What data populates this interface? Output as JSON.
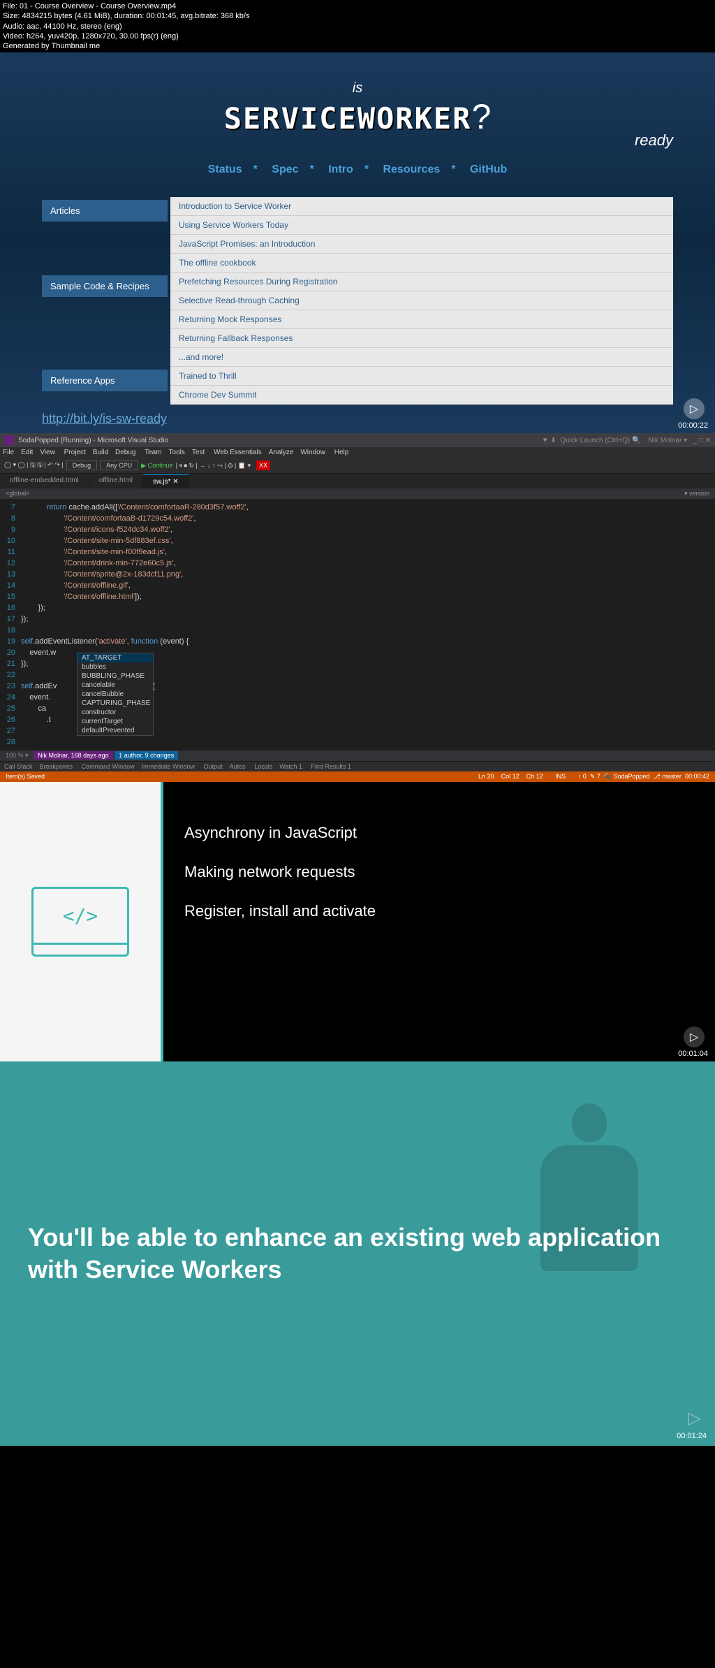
{
  "meta": {
    "file": "File: 01 - Course Overview - Course Overview.mp4",
    "size": "Size: 4834215 bytes (4.61 MiB), duration: 00:01:45, avg.bitrate: 368 kb/s",
    "audio": "Audio: aac, 44100 Hz, stereo (eng)",
    "video": "Video: h264, yuv420p, 1280x720, 30.00 fps(r) (eng)",
    "gen": "Generated by Thumbnail me"
  },
  "panel1": {
    "logo_is": "is",
    "logo_main": "SERVICEWORKER",
    "logo_ready": "ready",
    "logo_q": "?",
    "nav": [
      "Status",
      "*",
      "Spec",
      "*",
      "Intro",
      "*",
      "Resources",
      "*",
      "GitHub"
    ],
    "sections": [
      {
        "header": "Articles",
        "items": [
          "Introduction to Service Worker",
          "Using Service Workers Today",
          "JavaScript Promises: an Introduction",
          "The offline cookbook"
        ]
      },
      {
        "header": "Sample Code & Recipes",
        "items": [
          "Prefetching Resources During Registration",
          "Selective Read-through Caching",
          "Returning Mock Responses",
          "Returning Fallback Responses",
          "...and more!"
        ]
      },
      {
        "header": "Reference Apps",
        "items": [
          "Trained to Thrill",
          "Chrome Dev Summit"
        ]
      }
    ],
    "url": "http://bit.ly/is-sw-ready",
    "timestamp": "00:00:22"
  },
  "panel2": {
    "title": "SodaPopped (Running) - Microsoft Visual Studio",
    "quicklaunch": "Quick Launch (Ctrl+Q)",
    "user": "Nik Molnar",
    "menu": [
      "File",
      "Edit",
      "View",
      "Project",
      "Build",
      "Debug",
      "Team",
      "Tools",
      "Test",
      "Web Essentials",
      "Analyze",
      "Window",
      "Help"
    ],
    "toolbar_debug": "Debug",
    "toolbar_cpu": "Any CPU",
    "toolbar_continue": "Continue",
    "tabs": [
      "offline-embedded.html",
      "offline.html",
      "sw.js*"
    ],
    "breadcrumb_left": "<global>",
    "breadcrumb_right": "version",
    "code": [
      {
        "n": "7",
        "t": "            return cache.addAll(['/Content/comfortaaR-280d3f57.woff2',"
      },
      {
        "n": "8",
        "t": "                    '/Content/comfortaaB-d1729c54.woff2',"
      },
      {
        "n": "9",
        "t": "                    '/Content/icons-f524dc34.woff2',"
      },
      {
        "n": "10",
        "t": "                    '/Content/site-min-5df883ef.css',"
      },
      {
        "n": "11",
        "t": "                    '/Content/site-min-f00f9ead.js',"
      },
      {
        "n": "12",
        "t": "                    '/Content/drink-min-772e60c5.js',"
      },
      {
        "n": "13",
        "t": "                    '/Content/sprite@2x-183dcf11.png',"
      },
      {
        "n": "14",
        "t": "                    '/Content/offline.gif',"
      },
      {
        "n": "15",
        "t": "                    '/Content/offline.html']);"
      },
      {
        "n": "16",
        "t": "        });"
      },
      {
        "n": "17",
        "t": "});"
      },
      {
        "n": "18",
        "t": ""
      },
      {
        "n": "19",
        "t": "self.addEventListener('activate', function (event) {"
      },
      {
        "n": "20",
        "t": "    event.w"
      },
      {
        "n": "21",
        "t": "});"
      },
      {
        "n": "22",
        "t": ""
      },
      {
        "n": "23",
        "t": "self.addEv                    unction (event) {"
      },
      {
        "n": "24",
        "t": "    event."
      },
      {
        "n": "25",
        "t": "        ca                     st)"
      },
      {
        "n": "26",
        "t": "            .t"
      },
      {
        "n": "27",
        "t": ""
      },
      {
        "n": "28",
        "t": ""
      }
    ],
    "intellisense": [
      "AT_TARGET",
      "bubbles",
      "BUBBLING_PHASE",
      "cancelable",
      "cancelBubble",
      "CAPTURING_PHASE",
      "constructor",
      "currentTarget",
      "defaultPrevented"
    ],
    "scale": "100 %",
    "git_author": "Nik Molnar, 168 days ago",
    "git_changes": "1 author, 9 changes",
    "bottom_tabs": [
      "Call Stack",
      "Breakpoints",
      "Command Window",
      "Immediate Window",
      "Output",
      "Autos",
      "Locals",
      "Watch 1",
      "Find Results 1"
    ],
    "status_saved": "Item(s) Saved",
    "status_ln": "Ln 20",
    "status_col": "Col 12",
    "status_ch": "Ch 12",
    "status_ins": "INS",
    "status_up": "↑ 0",
    "status_pen": "✎ 7",
    "status_proj": "SodaPopped",
    "status_master": "master",
    "timestamp": "00:00:42"
  },
  "panel3": {
    "lines": [
      "Asynchrony in JavaScript",
      "Making network requests",
      "Register, install and activate"
    ],
    "code_symbol": "</>",
    "timestamp": "00:01:04"
  },
  "panel4": {
    "text": "You'll be able to enhance an existing web application with Service Workers",
    "timestamp": "00:01:24"
  }
}
